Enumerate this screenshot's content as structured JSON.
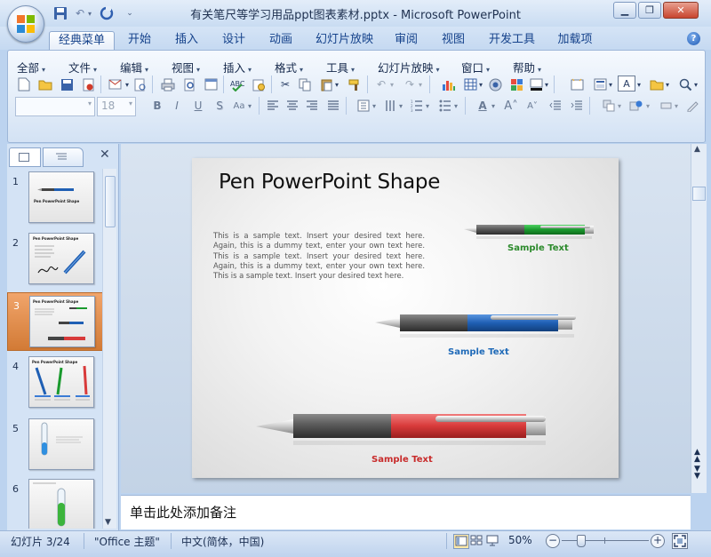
{
  "window": {
    "title": "有关笔尺等学习用品ppt图表素材.pptx - Microsoft PowerPoint"
  },
  "tabs": [
    "经典菜单",
    "开始",
    "插入",
    "设计",
    "动画",
    "幻灯片放映",
    "审阅",
    "视图",
    "开发工具",
    "加载项"
  ],
  "active_tab": "经典菜单",
  "menus": [
    "全部",
    "文件",
    "编辑",
    "视图",
    "插入",
    "格式",
    "工具",
    "幻灯片放映",
    "窗口",
    "帮助"
  ],
  "font_size_value": "18",
  "thumbnails": [
    {
      "num": "1",
      "title": "Pen PowerPoint Shape"
    },
    {
      "num": "2",
      "title": "Pen PowerPoint Shape"
    },
    {
      "num": "3",
      "title": "Pen PowerPoint Shape"
    },
    {
      "num": "4",
      "title": "Pen PowerPoint Shape"
    },
    {
      "num": "5",
      "title": ""
    },
    {
      "num": "6",
      "title": ""
    }
  ],
  "selected_slide": "3",
  "slide": {
    "title": "Pen PowerPoint Shape",
    "body": "This is a sample text. Insert your desired text here. Again, this is a dummy text, enter your own text here. This is a sample text. Insert your desired text here. Again, this is a dummy text, enter your own text here. This is a sample text. Insert your desired text here.",
    "pens": [
      {
        "caption": "Sample Text",
        "color": "#1a9a2e",
        "caption_color": "#2c8a2c"
      },
      {
        "caption": "Sample Text",
        "color": "#1f5fb4",
        "caption_color": "#1f6ab8"
      },
      {
        "caption": "Sample Text",
        "color": "#d83a3a",
        "caption_color": "#c82b2b"
      }
    ]
  },
  "notes_placeholder": "单击此处添加备注",
  "status": {
    "slide_info": "幻灯片 3/24",
    "theme": "\"Office 主题\"",
    "language": "中文(简体，中国)",
    "zoom": "50%"
  },
  "colors": {
    "accent_orange": "#f0a060",
    "ribbon_blue": "#dbe7f6"
  }
}
